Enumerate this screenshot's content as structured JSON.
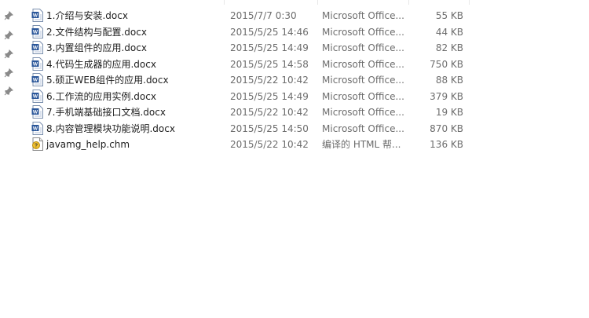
{
  "files": [
    {
      "name": "1.介绍与安装.docx",
      "date": "2015/7/7 0:30",
      "type": "Microsoft Office...",
      "size": "55 KB",
      "icon": "word-doc-icon"
    },
    {
      "name": "2.文件结构与配置.docx",
      "date": "2015/5/25 14:46",
      "type": "Microsoft Office...",
      "size": "44 KB",
      "icon": "word-doc-icon"
    },
    {
      "name": "3.内置组件的应用.docx",
      "date": "2015/5/25 14:49",
      "type": "Microsoft Office...",
      "size": "82 KB",
      "icon": "word-doc-icon"
    },
    {
      "name": "4.代码生成器的应用.docx",
      "date": "2015/5/25 14:58",
      "type": "Microsoft Office...",
      "size": "750 KB",
      "icon": "word-doc-icon"
    },
    {
      "name": "5.硕正WEB组件的应用.docx",
      "date": "2015/5/22 10:42",
      "type": "Microsoft Office...",
      "size": "88 KB",
      "icon": "word-doc-icon"
    },
    {
      "name": "6.工作流的应用实例.docx",
      "date": "2015/5/25 14:49",
      "type": "Microsoft Office...",
      "size": "379 KB",
      "icon": "word-doc-icon"
    },
    {
      "name": "7.手机端基础接口文档.docx",
      "date": "2015/5/22 10:42",
      "type": "Microsoft Office...",
      "size": "19 KB",
      "icon": "word-doc-icon"
    },
    {
      "name": "8.内容管理模块功能说明.docx",
      "date": "2015/5/25 14:50",
      "type": "Microsoft Office...",
      "size": "870 KB",
      "icon": "word-doc-icon"
    },
    {
      "name": "javamg_help.chm",
      "date": "2015/5/22 10:42",
      "type": "编译的 HTML 帮...",
      "size": "136 KB",
      "icon": "chm-help-icon"
    }
  ],
  "colors": {
    "word": "#2b579a",
    "pin": "#8a8a8a",
    "row_hover": "#e5f3ff"
  }
}
